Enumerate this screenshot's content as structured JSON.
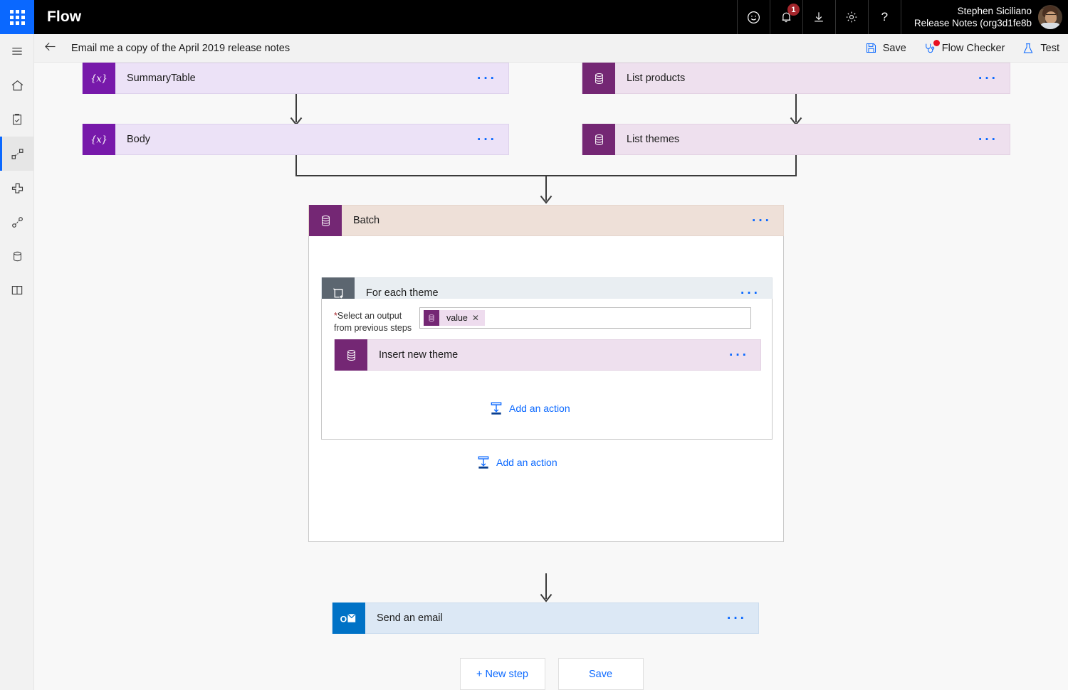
{
  "topbar": {
    "waffle_label": "app-launcher",
    "app_title": "Flow",
    "icons": [
      {
        "name": "smiley-icon",
        "label": "Feedback"
      },
      {
        "name": "bell-icon",
        "label": "Notifications",
        "badge": "1"
      },
      {
        "name": "download-icon",
        "label": "Download"
      },
      {
        "name": "gear-icon",
        "label": "Settings"
      },
      {
        "name": "help-icon",
        "label": "?"
      }
    ],
    "user_name": "Stephen Siciliano",
    "user_env": "Release Notes (org3d1fe8b"
  },
  "commandbar": {
    "back_label": "Back",
    "flow_name": "Email me a copy of the April 2019 release notes",
    "save_label": "Save",
    "flow_checker_label": "Flow Checker",
    "test_label": "Test"
  },
  "rail": {
    "items": [
      {
        "name": "hamburger-icon",
        "label": "Menu",
        "selected": false
      },
      {
        "name": "home-icon",
        "label": "Home",
        "selected": false
      },
      {
        "name": "approvals-icon",
        "label": "Approvals",
        "selected": false
      },
      {
        "name": "flows-icon",
        "label": "My flows",
        "selected": true
      },
      {
        "name": "templates-icon",
        "label": "Templates",
        "selected": false
      },
      {
        "name": "connectors-icon",
        "label": "Connectors",
        "selected": false
      },
      {
        "name": "data-icon",
        "label": "Data",
        "selected": false
      },
      {
        "name": "learn-icon",
        "label": "Learn",
        "selected": false
      }
    ]
  },
  "canvas": {
    "cards": {
      "summary_table": {
        "title": "SummaryTable",
        "icon": "variable-icon",
        "ellipsis": "···"
      },
      "body": {
        "title": "Body",
        "icon": "variable-icon",
        "ellipsis": "···"
      },
      "list_products": {
        "title": "List products",
        "icon": "database-icon",
        "ellipsis": "···"
      },
      "list_themes": {
        "title": "List themes",
        "icon": "database-icon",
        "ellipsis": "···"
      },
      "batch": {
        "title": "Batch",
        "icon": "database-icon",
        "ellipsis": "···"
      },
      "for_each_theme": {
        "title": "For each theme",
        "icon": "loop-icon",
        "ellipsis": "···"
      },
      "insert_new_theme": {
        "title": "Insert new theme",
        "icon": "database-icon",
        "ellipsis": "···"
      },
      "send_an_email": {
        "title": "Send an email",
        "icon": "outlook-icon",
        "ellipsis": "···"
      }
    },
    "loop_param": {
      "label_required": "*",
      "label_line1": "Select an output",
      "label_line2": "from previous steps",
      "token_text": "value",
      "token_remove": "✕",
      "token_icon": "database-icon"
    },
    "add_action_inner": "Add an action",
    "add_action_outer": "Add an action"
  },
  "footer": {
    "new_step_label": "+ New step",
    "save_label": "Save"
  },
  "colors": {
    "accent_blue": "#0a68ff",
    "waffle_blue": "#0a68ff",
    "variable_purple": "#7719aa",
    "database_magenta": "#742774",
    "outlook_blue": "#0072c6",
    "loop_slate": "#5c6670",
    "badge_red": "#a4262c",
    "checker_dot_red": "#e81123",
    "variable_card_bg": "#ece2f7",
    "database_card_bg": "#eee0ee",
    "batch_card_bg": "#eee0d8",
    "loop_card_bg": "#e9eef2",
    "outlook_card_bg": "#dce8f5"
  }
}
